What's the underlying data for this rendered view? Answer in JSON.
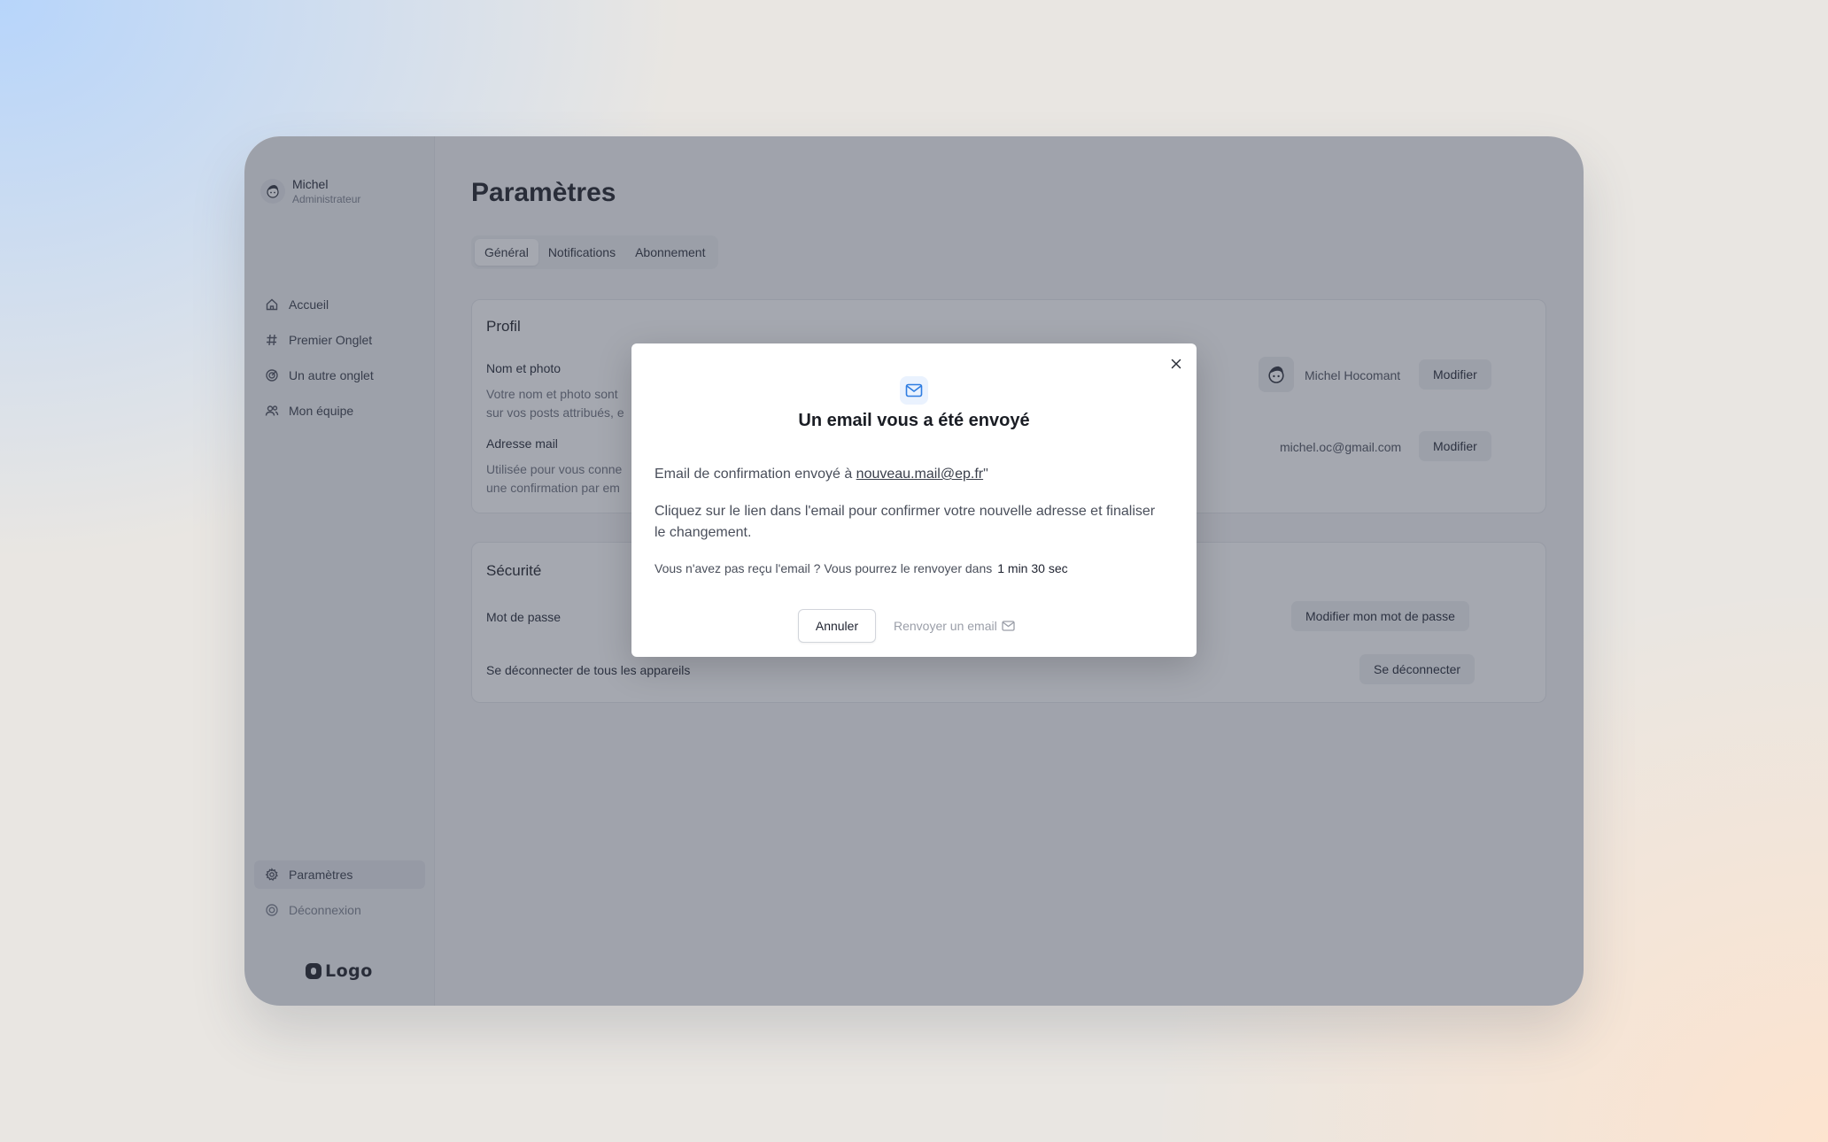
{
  "user": {
    "name": "Michel",
    "role": "Administrateur"
  },
  "nav": {
    "top": [
      {
        "label": "Accueil",
        "icon": "home-icon"
      },
      {
        "label": "Premier Onglet",
        "icon": "hash-icon"
      },
      {
        "label": "Un autre onglet",
        "icon": "target-icon"
      },
      {
        "label": "Mon équipe",
        "icon": "team-icon"
      }
    ],
    "bottom": [
      {
        "label": "Paramètres",
        "icon": "gear-icon",
        "active": true
      },
      {
        "label": "Déconnexion",
        "icon": "logout-icon"
      }
    ]
  },
  "logo": {
    "text": "Logo"
  },
  "page": {
    "title": "Paramètres",
    "tabs": [
      {
        "label": "Général",
        "active": true
      },
      {
        "label": "Notifications"
      },
      {
        "label": "Abonnement"
      }
    ]
  },
  "profile": {
    "title": "Profil",
    "name_label": "Nom et photo",
    "name_desc_1": "Votre nom et photo sont",
    "name_desc_2": "sur vos posts attribués, e",
    "name_value": "Michel Hocomant",
    "name_button": "Modifier",
    "email_label": "Adresse mail",
    "email_desc_1": "Utilisée pour vous conne",
    "email_desc_2": "une confirmation par em",
    "email_value": "michel.oc@gmail.com",
    "email_button": "Modifier"
  },
  "security": {
    "title": "Sécurité",
    "password_label": "Mot de passe",
    "password_button": "Modifier mon mot de passe",
    "logout_all_label": "Se déconnecter de tous les appareils",
    "logout_all_button": "Se déconnecter"
  },
  "modal": {
    "title": "Un email vous a été envoyé",
    "line1_prefix": "Email de confirmation envoyé à ",
    "line1_email": "nouveau.mail@ep.fr",
    "line1_suffix": "\"",
    "line2": "Cliquez sur le lien dans l'email pour confirmer votre nouvelle adresse et finaliser le changement.",
    "resend_info": "Vous n'avez pas reçu l'email ? Vous pourrez le renvoyer dans",
    "timer": "1 min 30 sec",
    "cancel_label": "Annuler",
    "resend_label": "Renvoyer un email"
  },
  "colors": {
    "accent": "#2f7de1",
    "overlay": "#3a4252"
  }
}
